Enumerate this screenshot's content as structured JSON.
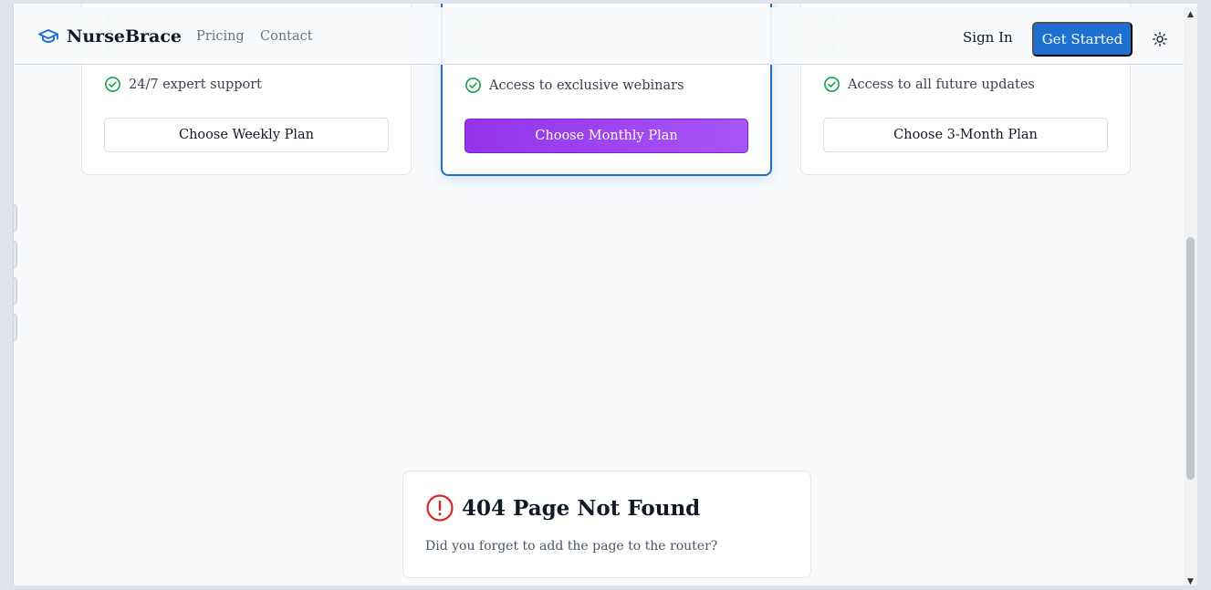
{
  "brand": {
    "name": "NurseBrace",
    "logo_icon": "graduation-cap-icon",
    "accent": "#1d6fd1"
  },
  "nav": {
    "links": [
      "Pricing",
      "Contact"
    ],
    "sign_in": "Sign In",
    "get_started": "Get Started",
    "theme_icon": "sun-icon"
  },
  "plans": [
    {
      "feature": "24/7 expert support",
      "button": "Choose Weekly Plan"
    },
    {
      "feature": "Access to exclusive webinars",
      "button": "Choose Monthly Plan",
      "highlighted": true,
      "button_color": "#9333ea"
    },
    {
      "feature": "Access to all future updates",
      "button": "Choose 3-Month Plan"
    }
  ],
  "not_found": {
    "title": "404 Page Not Found",
    "message": "Did you forget to add the page to the router?",
    "icon": "alert-circle-icon",
    "icon_color": "#dc2626"
  },
  "colors": {
    "check": "#16a34a"
  }
}
